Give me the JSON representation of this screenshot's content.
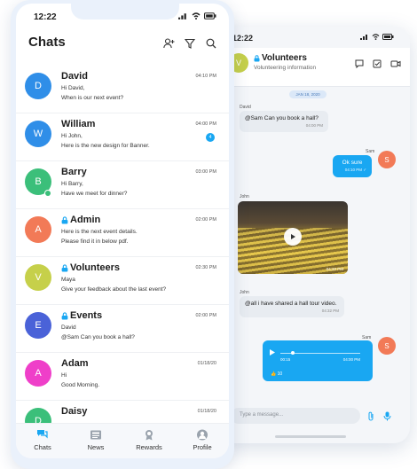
{
  "colors": {
    "accent": "#19a7f2",
    "online": "#3bbf7a",
    "outgoing_bubble": "#19a7f2",
    "incoming_bubble": "#e8ecf1"
  },
  "front": {
    "status_time": "12:22",
    "title": "Chats",
    "header_icons": [
      "add-user-icon",
      "filter-icon",
      "search-icon"
    ],
    "chats": [
      {
        "avatar": "D",
        "color": "#2f8ee8",
        "name": "David",
        "locked": false,
        "online": false,
        "line1": "Hi David,",
        "line2": "When is our next event?",
        "time": "04:10 PM",
        "unread": ""
      },
      {
        "avatar": "W",
        "color": "#2f8ee8",
        "name": "William",
        "locked": false,
        "online": false,
        "line1": "Hi John,",
        "line2": "Here is the new design for Banner.",
        "time": "04:00 PM",
        "unread": "4"
      },
      {
        "avatar": "B",
        "color": "#3bbf7a",
        "name": "Barry",
        "locked": false,
        "online": true,
        "line1": "Hi Barry,",
        "line2": "Have we meet for dinner?",
        "time": "03:00 PM",
        "unread": ""
      },
      {
        "avatar": "A",
        "color": "#f27a57",
        "name": "Admin",
        "locked": true,
        "online": false,
        "line1": "Here is the next event details.",
        "line2": "Please find it in below pdf.",
        "time": "02:00 PM",
        "unread": ""
      },
      {
        "avatar": "V",
        "color": "#c6d04a",
        "name": "Volunteers",
        "locked": true,
        "online": false,
        "line1": "Maya",
        "line2": "Give your feedback about the last event?",
        "time": "02:30 PM",
        "unread": ""
      },
      {
        "avatar": "E",
        "color": "#4a62d8",
        "name": "Events",
        "locked": true,
        "online": false,
        "line1": "David",
        "line2": "@Sam Can you book a hall?",
        "time": "02:00 PM",
        "unread": ""
      },
      {
        "avatar": "A",
        "color": "#ef3fc9",
        "name": "Adam",
        "locked": false,
        "online": false,
        "line1": "Hi",
        "line2": "Good Morning.",
        "time": "01/18/20",
        "unread": ""
      },
      {
        "avatar": "D",
        "color": "#3bbf7a",
        "name": "Daisy",
        "locked": false,
        "online": false,
        "line1": "",
        "line2": "",
        "time": "01/18/20",
        "unread": ""
      }
    ],
    "tabs": [
      {
        "label": "Chats",
        "icon": "chats-icon",
        "active": true
      },
      {
        "label": "News",
        "icon": "news-icon",
        "active": false
      },
      {
        "label": "Rewards",
        "icon": "rewards-icon",
        "active": false
      },
      {
        "label": "Profile",
        "icon": "profile-icon",
        "active": false
      }
    ]
  },
  "back": {
    "status_time": "12:22",
    "group": {
      "avatar": "V",
      "name": "Volunteers",
      "subtitle": "Volunteering information"
    },
    "header_icons": [
      "chat-bubble-icon",
      "checkbox-icon",
      "video-camera-icon"
    ],
    "date": "JAN 18, 2020",
    "messages": {
      "m1": {
        "sender": "David",
        "text": "@Sam Can you book a hall?",
        "time": "04:00 PM"
      },
      "m2": {
        "sender": "Sam",
        "avatar": "S",
        "text": "Ok sure",
        "time": "04:10 PM ✓"
      },
      "m3": {
        "sender": "John",
        "time": "04:20 PM"
      },
      "m4": {
        "sender": "John",
        "text": "@all i have shared a hall tour video.",
        "time": "04:32 PM"
      },
      "m5": {
        "sender": "Sam",
        "avatar": "S",
        "start": "00:15",
        "end": "04:00 PM",
        "reaction": "👍 10"
      }
    },
    "input_placeholder": "Type a message..."
  }
}
